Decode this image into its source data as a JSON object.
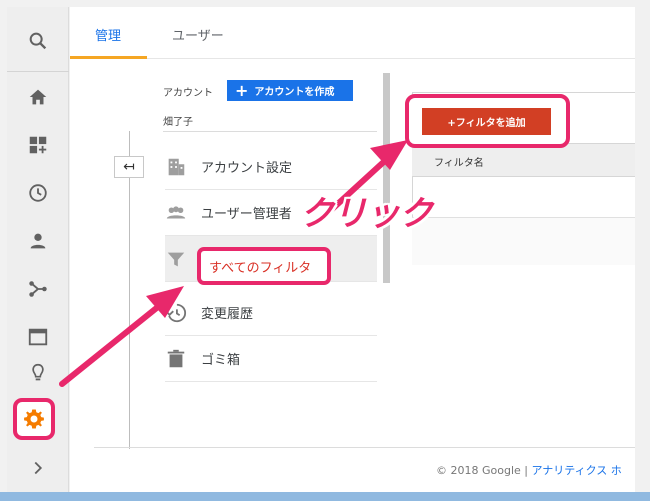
{
  "tabs": {
    "admin": "管理",
    "users": "ユーザー"
  },
  "account": {
    "label": "アカウント",
    "create_button": "アカウントを作成",
    "name": "畑了子"
  },
  "menu": {
    "items": [
      {
        "label": "アカウント設定",
        "icon": "building-icon"
      },
      {
        "label": "ユーザー管理者",
        "icon": "people-icon"
      },
      {
        "label": "すべてのフィルタ",
        "icon": "filter-icon"
      },
      {
        "label": "変更履歴",
        "icon": "history-icon"
      },
      {
        "label": "ゴミ箱",
        "icon": "trash-icon"
      }
    ]
  },
  "filters": {
    "add_button": "+フィルタを追加",
    "column_header": "フィルタ名"
  },
  "annotation": {
    "click_label": "クリック"
  },
  "footer": {
    "copyright": "© 2018 Google",
    "separator": "|",
    "link": "アナリティクス ホ"
  },
  "colors": {
    "accent": "#1a73e8",
    "highlight": "#e8286b",
    "add_button": "#d23f24",
    "tab_underline": "#f5a623"
  }
}
